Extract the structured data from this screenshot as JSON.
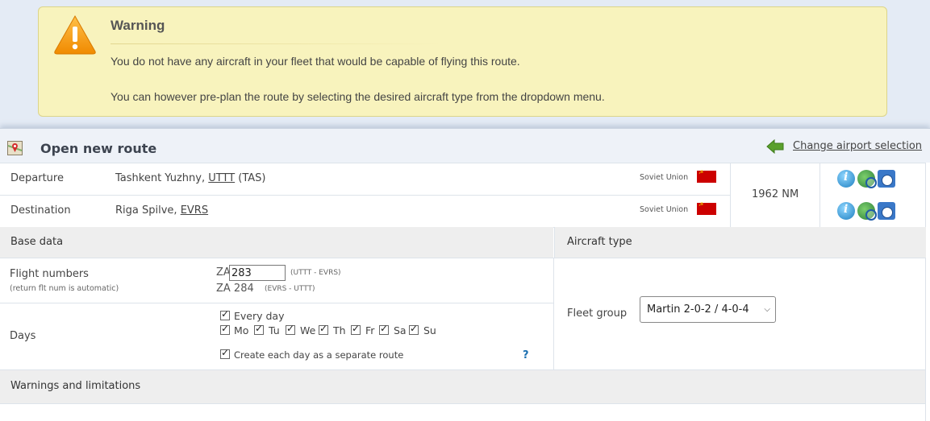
{
  "warning": {
    "title": "Warning",
    "line1": "You do not have any aircraft in your fleet that would be capable of flying this route.",
    "line2": "You can however pre-plan the route by selecting the desired aircraft type from the dropdown menu.",
    "icon": "warning-triangle-icon"
  },
  "header": {
    "title": "Open new route",
    "change_link": "Change airport selection"
  },
  "route": {
    "departure": {
      "label": "Departure",
      "name": "Tashkent Yuzhny, ",
      "icao": "UTTT",
      "iata": " (TAS)",
      "country": "Soviet Union"
    },
    "destination": {
      "label": "Destination",
      "name": "Riga Spilve, ",
      "icao": "EVRS",
      "iata": "",
      "country": "Soviet Union"
    },
    "distance": "1962 NM"
  },
  "base": {
    "title": "Base data",
    "flight_numbers_label": "Flight numbers",
    "flight_numbers_note": "(return flt num is automatic)",
    "prefix": "ZA",
    "outbound_number": "283",
    "outbound_route": "(UTTT - EVRS)",
    "return_number": "ZA 284",
    "return_route": "(EVRS - UTTT)",
    "days_label": "Days",
    "every_day": "Every day",
    "days": [
      "Mo",
      "Tu",
      "We",
      "Th",
      "Fr",
      "Sa",
      "Su"
    ],
    "separate_route": "Create each day as a separate route",
    "help": "?"
  },
  "aircraft": {
    "title": "Aircraft type",
    "fleet_group_label": "Fleet group",
    "fleet_group_value": "Martin 2-0-2 / 4-0-4"
  },
  "warnings_section": {
    "title": "Warnings and limitations"
  },
  "colors": {
    "warning_bg": "#f8f3bd",
    "link_arrow": "#5aa02c",
    "flag": "#cc0000"
  }
}
